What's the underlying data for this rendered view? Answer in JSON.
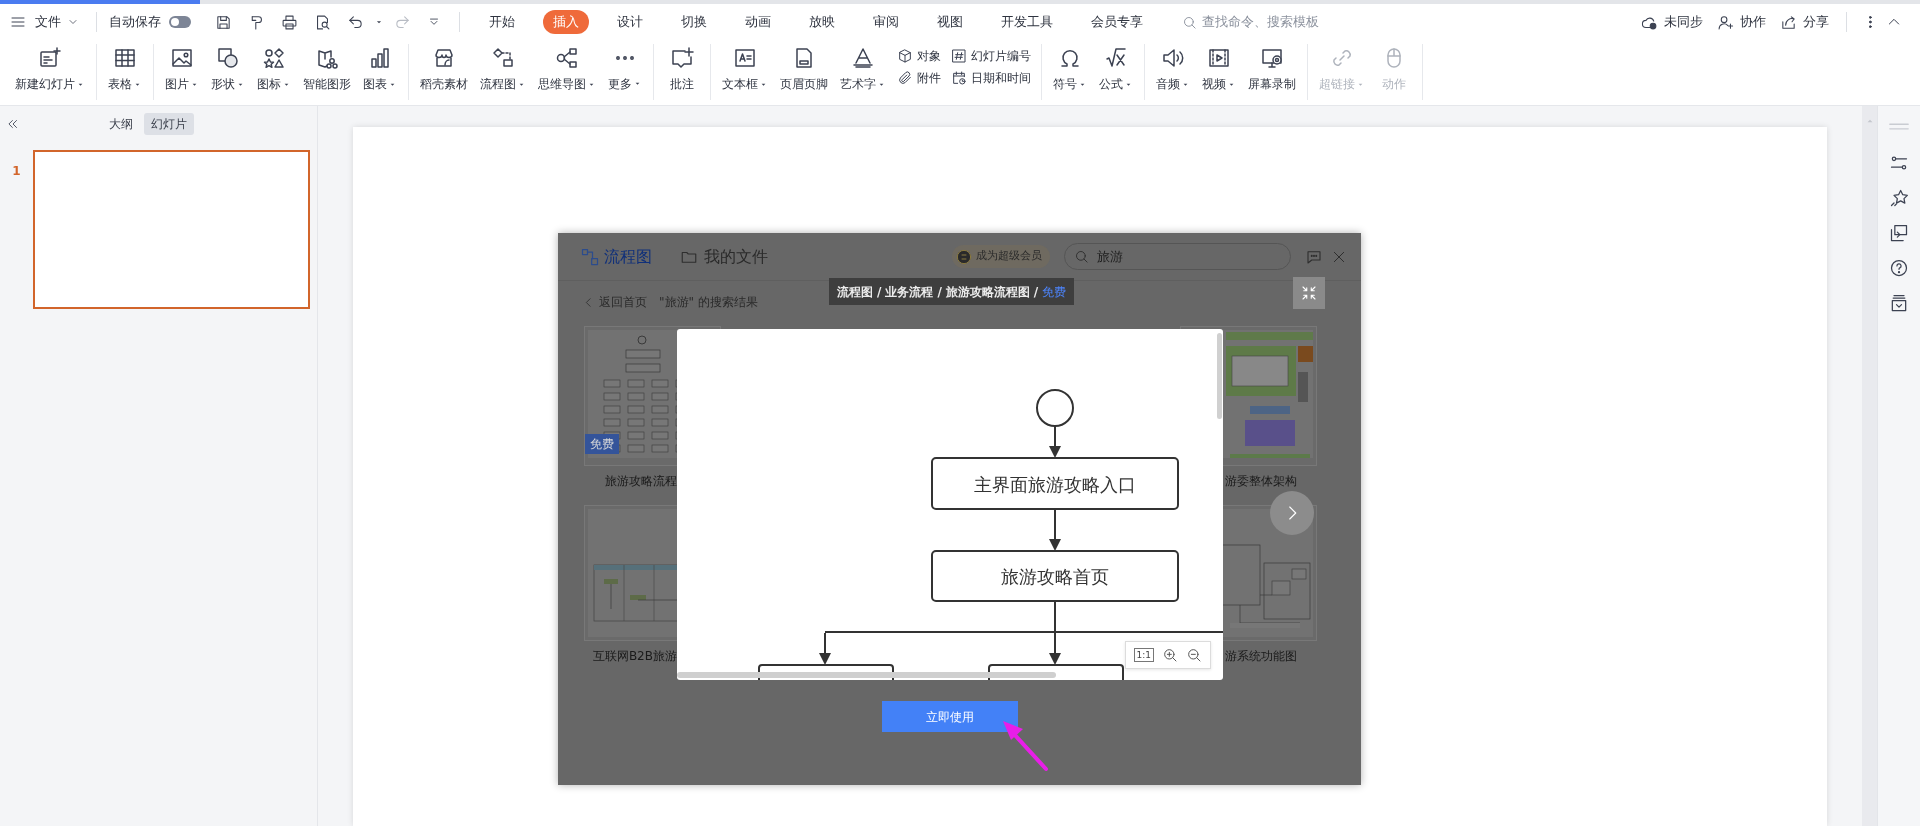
{
  "menu_bar": {
    "file_menu": "文件",
    "autosave": {
      "label": "自动保存",
      "on": false
    },
    "quick_access": [
      {
        "disabled": false
      },
      {
        "disabled": false
      },
      {
        "disabled": false
      },
      {
        "disabled": false
      },
      {
        "disabled": false
      },
      {
        "disabled": true
      }
    ],
    "tabs": [
      {
        "label": "开始",
        "selected": false
      },
      {
        "label": "插入",
        "selected": true
      },
      {
        "label": "设计",
        "selected": false
      },
      {
        "label": "切换",
        "selected": false
      },
      {
        "label": "动画",
        "selected": false
      },
      {
        "label": "放映",
        "selected": false
      },
      {
        "label": "审阅",
        "selected": false
      },
      {
        "label": "视图",
        "selected": false
      },
      {
        "label": "开发工具",
        "selected": false
      },
      {
        "label": "会员专享",
        "selected": false
      }
    ],
    "command_search": {
      "placeholder": "查找命令、搜索模板"
    },
    "actions": [
      "未同步",
      "协作",
      "分享"
    ]
  },
  "ribbon_groups": [
    {
      "disabled": false,
      "items": [
        {
          "kind": "large",
          "label": "新建幻灯片",
          "dropdown": true
        }
      ]
    },
    {
      "disabled": false,
      "items": [
        {
          "kind": "large",
          "label": "表格",
          "dropdown": true
        }
      ]
    },
    {
      "disabled": false,
      "items": [
        {
          "kind": "large",
          "label": "图片",
          "dropdown": true
        },
        {
          "kind": "large",
          "label": "形状",
          "dropdown": true
        },
        {
          "kind": "large",
          "label": "图标",
          "dropdown": true
        },
        {
          "kind": "large",
          "label": "智能图形",
          "dropdown": false
        },
        {
          "kind": "large",
          "label": "图表",
          "dropdown": true
        }
      ]
    },
    {
      "disabled": false,
      "items": [
        {
          "kind": "large",
          "label": "稻壳素材",
          "dropdown": false
        },
        {
          "kind": "large",
          "label": "流程图",
          "dropdown": true
        },
        {
          "kind": "large",
          "label": "思维导图",
          "dropdown": true
        },
        {
          "kind": "large",
          "label": "更多",
          "dropdown": true
        }
      ]
    },
    {
      "disabled": false,
      "items": [
        {
          "kind": "large",
          "label": "批注",
          "dropdown": false
        }
      ]
    },
    {
      "disabled": false,
      "items": [
        {
          "kind": "large",
          "label": "文本框",
          "dropdown": true
        },
        {
          "kind": "large",
          "label": "页眉页脚",
          "dropdown": false
        },
        {
          "kind": "large",
          "label": "艺术字",
          "dropdown": true
        },
        {
          "kind": "stack",
          "items": [
            "对象",
            "附件"
          ]
        },
        {
          "kind": "stack",
          "items": [
            "幻灯片编号",
            "日期和时间"
          ]
        }
      ]
    },
    {
      "disabled": false,
      "items": [
        {
          "kind": "large",
          "label": "符号",
          "dropdown": true
        },
        {
          "kind": "large",
          "label": "公式",
          "dropdown": true
        }
      ]
    },
    {
      "disabled": false,
      "items": [
        {
          "kind": "large",
          "label": "音频",
          "dropdown": true
        },
        {
          "kind": "large",
          "label": "视频",
          "dropdown": true
        },
        {
          "kind": "large",
          "label": "屏幕录制",
          "dropdown": false
        }
      ]
    },
    {
      "disabled": true,
      "items": [
        {
          "kind": "large",
          "label": "超链接",
          "dropdown": true
        },
        {
          "kind": "large",
          "label": "动作",
          "dropdown": false
        }
      ]
    }
  ],
  "slide_panel": {
    "tabs": [
      {
        "label": "大纲",
        "selected": false
      },
      {
        "label": "幻灯片",
        "selected": true
      }
    ],
    "slides": [
      {
        "number": "1",
        "selected": true
      }
    ]
  },
  "flowchart_dialog": {
    "title": "流程图",
    "my_files": "我的文件",
    "vip_badge": "成为超级会员",
    "search": {
      "value": "旅游"
    },
    "breadcrumb": [
      {
        "text": "流程图",
        "highlight": false
      },
      {
        "text": "/",
        "highlight": false
      },
      {
        "text": "业务流程",
        "highlight": false
      },
      {
        "text": "/",
        "highlight": false
      },
      {
        "text": "旅游攻略流程图",
        "highlight": false
      },
      {
        "text": "/",
        "highlight": false
      },
      {
        "text": "免费",
        "highlight": true
      }
    ],
    "back_link": "返回首页",
    "results_title": "\"旅游\" 的搜索结果",
    "templates": [
      {
        "title": "旅游攻略流程",
        "badge": "免费"
      },
      {
        "title": "游委整体架构"
      },
      {
        "title": "互联网B2B旅游"
      },
      {
        "title": "游系统功能图"
      }
    ],
    "preview": {
      "nodes": [
        "主界面旅游攻略入口",
        "旅游攻略首页"
      ],
      "zoom_reset": "1:1"
    },
    "use_button": "立即使用"
  }
}
